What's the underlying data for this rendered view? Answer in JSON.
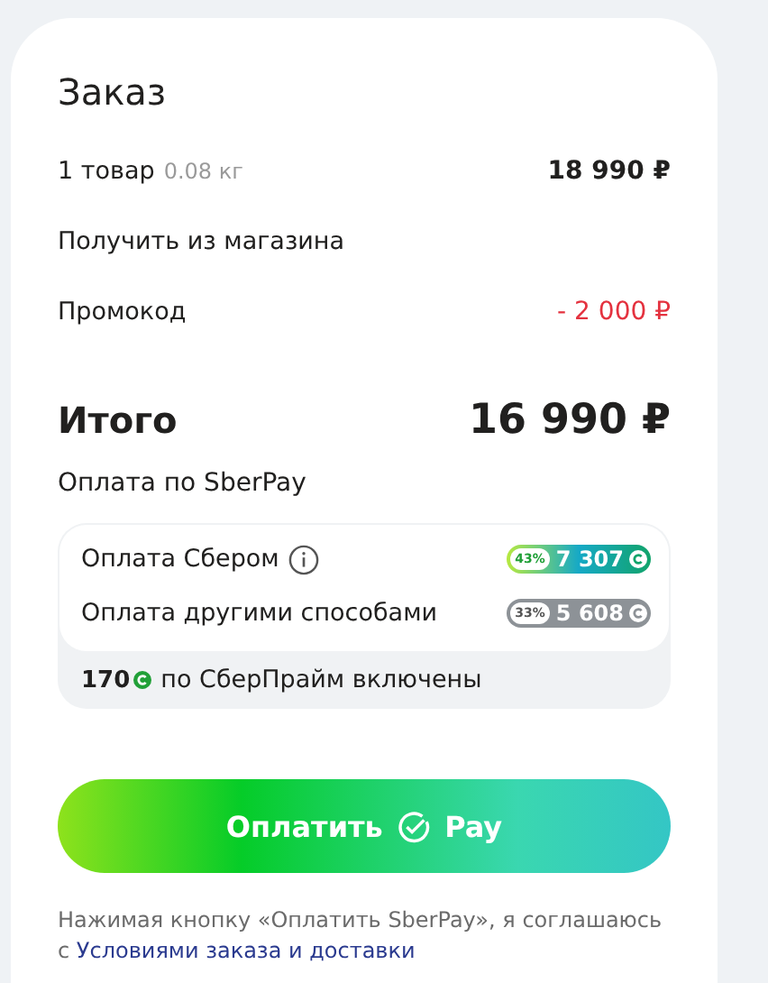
{
  "order": {
    "title": "Заказ",
    "lines": [
      {
        "kind": "item",
        "label": "1 товар",
        "note": "0.08 кг",
        "value": "18 990 ₽"
      },
      {
        "kind": "plain",
        "label": "Получить из магазина"
      },
      {
        "kind": "discount",
        "label": "Промокод",
        "value": "- 2 000 ₽"
      }
    ],
    "total": {
      "label": "Итого",
      "value": "16 990 ₽"
    },
    "payment_label": "Оплата по SberPay",
    "bonuses": {
      "options": [
        {
          "kind": "sber",
          "label": "Оплата Сбером",
          "info": true,
          "percent": "43%",
          "amount": "7 307"
        },
        {
          "kind": "other",
          "label": "Оплата другими способами",
          "info": false,
          "percent": "33%",
          "amount": "5 608"
        }
      ],
      "prime": {
        "amount": "170",
        "text": "по СберПрайм включены"
      }
    },
    "pay_button": {
      "label": "Оплатить",
      "suffix": "Pay"
    },
    "consent": {
      "text": "Нажимая кнопку «Оплатить SberPay», я соглашаюсь с",
      "link": "Условиями заказа и доставки"
    }
  }
}
